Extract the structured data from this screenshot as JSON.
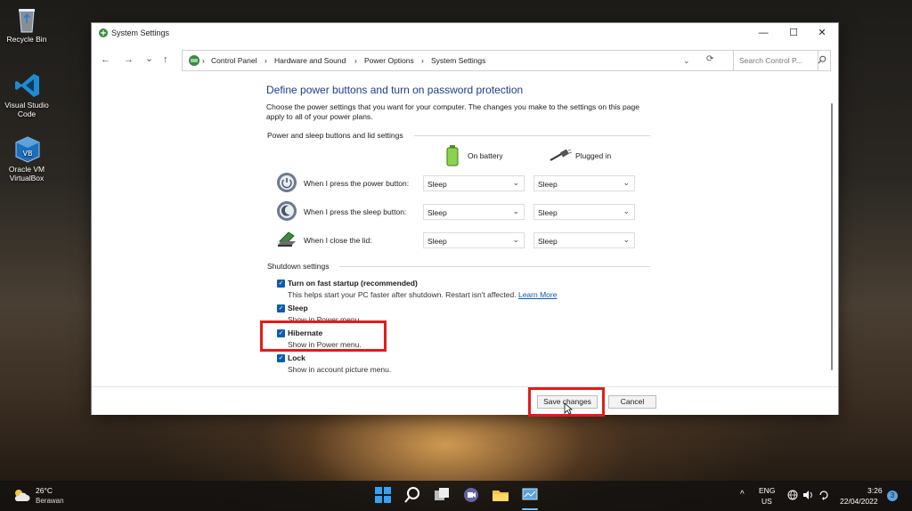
{
  "desktop": {
    "icons": [
      {
        "label": "Recycle Bin"
      },
      {
        "label": "Visual Studio Code"
      },
      {
        "label": "Oracle VM VirtualBox"
      }
    ]
  },
  "window": {
    "title": "System Settings",
    "controls": {
      "minimize": "—",
      "maximize": "☐",
      "close": "✕"
    }
  },
  "nav": {
    "back": "←",
    "forward": "→",
    "recent": "⌄",
    "up": "↑",
    "breadcrumb": [
      "Control Panel",
      "Hardware and Sound",
      "Power Options",
      "System Settings"
    ],
    "separator": "›",
    "search_placeholder": "Search Control P..."
  },
  "main": {
    "heading": "Define power buttons and turn on password protection",
    "description": "Choose the power settings that you want for your computer. The changes you make to the settings on this page apply to all of your power plans.",
    "section_buttons": "Power and sleep buttons and lid settings",
    "col_battery": "On battery",
    "col_plugged": "Plugged in",
    "rows": [
      {
        "label": "When I press the power button:",
        "battery": "Sleep",
        "plugged": "Sleep"
      },
      {
        "label": "When I press the sleep button:",
        "battery": "Sleep",
        "plugged": "Sleep"
      },
      {
        "label": "When I close the lid:",
        "battery": "Sleep",
        "plugged": "Sleep"
      }
    ],
    "section_shutdown": "Shutdown settings",
    "options": [
      {
        "title": "Turn on fast startup (recommended)",
        "sub": "This helps start your PC faster after shutdown. Restart isn't affected.",
        "link": "Learn More",
        "checked": true
      },
      {
        "title": "Sleep",
        "sub": "Show in Power menu.",
        "checked": true
      },
      {
        "title": "Hibernate",
        "sub": "Show in Power menu.",
        "checked": true
      },
      {
        "title": "Lock",
        "sub": "Show in account picture menu.",
        "checked": true
      }
    ]
  },
  "footer": {
    "save": "Save changes",
    "cancel": "Cancel"
  },
  "taskbar": {
    "weather_temp": "26°C",
    "weather_desc": "Berawan",
    "lang1": "ENG",
    "lang2": "US",
    "time": "3:26",
    "date": "22/04/2022",
    "notif_count": "3",
    "tray_up": "^"
  },
  "colors": {
    "accent": "#0b5cad",
    "highlight": "#e31b1b",
    "heading": "#1d3d8a"
  }
}
